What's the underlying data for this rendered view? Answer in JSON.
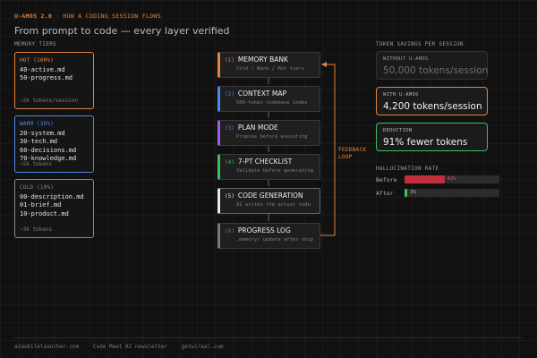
{
  "header": {
    "brand": "U-AMOS 2.0",
    "separator": "·",
    "flow_title": "HOW A CODING SESSION FLOWS",
    "headline": "From prompt to code — every layer verified"
  },
  "memory_tiers": {
    "label": "MEMORY TIERS",
    "tiers": [
      {
        "title": "HOT (100%)",
        "color": "#e8833a",
        "files": [
          "40-active.md",
          "50-progress.md"
        ],
        "tokens": "~2k tokens/session"
      },
      {
        "title": "WARM (30%)",
        "color": "#4a8ae8",
        "files": [
          "20-system.md",
          "30-tech.md",
          "60-decisions.md",
          "70-knowledge.md"
        ],
        "tokens": "~5k tokens"
      },
      {
        "title": "COLD (10%)",
        "color": "#8a8a8a",
        "files": [
          "00-description.md",
          "01-brief.md",
          "10-product.md"
        ],
        "tokens": "~3k tokens"
      }
    ]
  },
  "pipeline": {
    "steps": [
      {
        "num": "(1)",
        "title": "MEMORY BANK",
        "subtitle": "Cold / Warm / Hot tiers",
        "color": "#e8833a"
      },
      {
        "num": "(2)",
        "title": "CONTEXT MAP",
        "subtitle": "500-token codebase index",
        "color": "#4a8ae8"
      },
      {
        "num": "(3)",
        "title": "PLAN MODE",
        "subtitle": "Propose before executing",
        "color": "#9b5de5"
      },
      {
        "num": "(4)",
        "title": "7-PT CHECKLIST",
        "subtitle": "Validate before generating",
        "color": "#3fbf5f"
      },
      {
        "num": "(5)",
        "title": "CODE GENERATION",
        "subtitle": "AI writes the actual code",
        "color": "#e8e8e8"
      },
      {
        "num": "(6)",
        "title": "PROGRESS LOG",
        "subtitle": ".memory/ update after ship",
        "color": "#777777"
      }
    ],
    "feedback_label": [
      "FEEDBACK",
      "LOOP"
    ],
    "feedback_color": "#e8833a"
  },
  "token_savings": {
    "label": "TOKEN SAVINGS PER SESSION",
    "cards": [
      {
        "label": "WITHOUT U-AMOS",
        "value": "50,000 tokens/session",
        "border": "#333333",
        "value_color": "#6e6e6e",
        "label_color": "#9a9a9a"
      },
      {
        "label": "WITH U-AMOS",
        "value": "4,200 tokens/session",
        "border": "#e8833a",
        "value_color": "#f2f2f2",
        "label_color": "#b5b5b5"
      },
      {
        "label": "REDUCTION",
        "value": "91% fewer tokens",
        "border": "#3fbf5f",
        "value_color": "#f2f2f2",
        "label_color": "#b5b5b5"
      }
    ]
  },
  "hallucination": {
    "label": "HALLUCINATION RATE",
    "rows": [
      {
        "label": "Before",
        "value": "42%",
        "fraction": 0.42,
        "color": "#c0303a",
        "text_color": "#e0605c"
      },
      {
        "label": "After",
        "value": "3%",
        "fraction": 0.03,
        "color": "#3fbf5f",
        "text_color": "#bbbbbb"
      }
    ]
  },
  "footer": {
    "items": [
      "aimobilelauncher.com",
      "Code Meet AI newsletter",
      "getwireal.com"
    ],
    "separator": "·"
  }
}
